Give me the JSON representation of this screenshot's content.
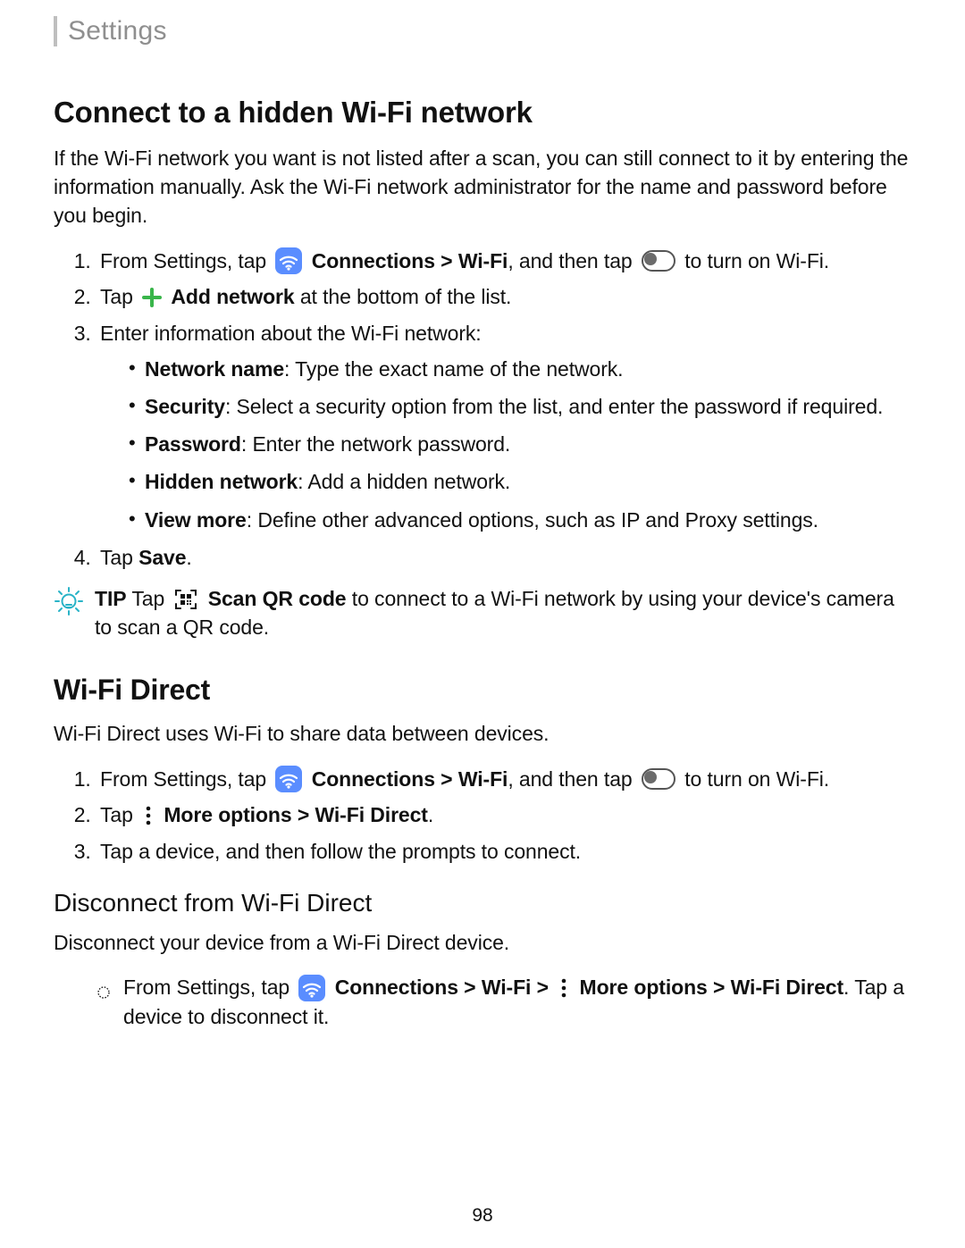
{
  "header": {
    "title": "Settings"
  },
  "section1": {
    "heading": "Connect to a hidden Wi-Fi network",
    "intro": "If the Wi-Fi network you want is not listed after a scan, you can still connect to it by entering the information manually. Ask the Wi-Fi network administrator for the name and password before you begin.",
    "steps": {
      "s1_prefix": "From Settings, tap ",
      "s1_conn": "Connections",
      "s1_wifi": "Wi-Fi",
      "s1_then": ", and then tap ",
      "s1_toggle_after": " to turn on Wi-Fi.",
      "s2_tap": "Tap ",
      "s2_addnet": "Add network",
      "s2_rest": " at the bottom of the list.",
      "s3": "Enter information about the Wi-Fi network:",
      "bullets": {
        "b1_label": "Network name",
        "b1_text": ": Type the exact name of the network.",
        "b2_label": "Security",
        "b2_text": ": Select a security option from the list, and enter the password if required.",
        "b3_label": "Password",
        "b3_text": ": Enter the network password.",
        "b4_label": "Hidden network",
        "b4_text": ": Add a hidden network.",
        "b5_label": "View more",
        "b5_text": ": Define other advanced options, such as IP and Proxy settings."
      },
      "s4_tap": "Tap ",
      "s4_save": "Save",
      "s4_dot": "."
    },
    "tip": {
      "label": "TIP",
      "tap": "  Tap",
      "scan": "Scan QR code",
      "rest": " to connect to a Wi-Fi network by using your device's camera to scan a QR code."
    }
  },
  "section2": {
    "heading": "Wi-Fi Direct",
    "intro": "Wi-Fi Direct uses Wi-Fi to share data between devices.",
    "steps": {
      "s1_prefix": "From Settings, tap ",
      "s1_conn": "Connections",
      "s1_wifi": "Wi-Fi",
      "s1_then": ", and then tap ",
      "s1_toggle_after": " to turn on Wi-Fi.",
      "s2_tap": "Tap ",
      "s2_more": "More options",
      "s2_wfd": "Wi-Fi Direct",
      "s2_dot": ".",
      "s3": "Tap a device, and then follow the prompts to connect."
    }
  },
  "section3": {
    "heading": "Disconnect from Wi-Fi Direct",
    "intro": "Disconnect your device from a Wi-Fi Direct device.",
    "step": {
      "prefix": "From Settings, tap ",
      "conn": "Connections",
      "wifi": "Wi-Fi",
      "more": "More options",
      "wfd": "Wi-Fi Direct",
      "rest": ". Tap a device to disconnect it."
    }
  },
  "page_number": "98",
  "glyphs": {
    "gt": " > "
  }
}
